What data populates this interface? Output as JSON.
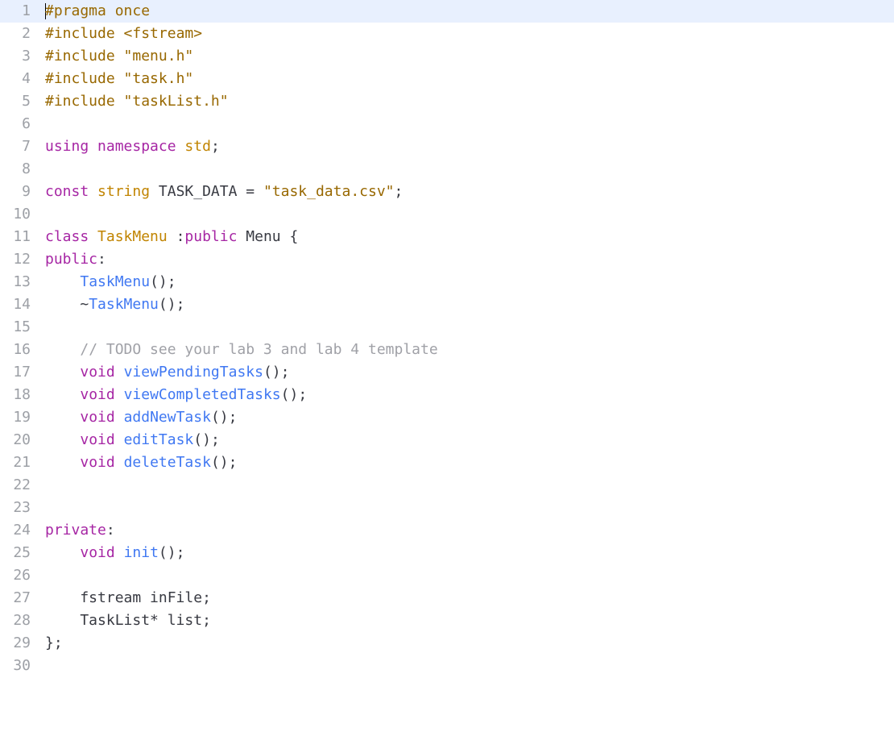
{
  "highlight_line": 1,
  "lines": [
    {
      "n": 1,
      "tokens": [
        {
          "t": "cursor"
        },
        {
          "c": "pp",
          "v": "#pragma"
        },
        {
          "c": "txt",
          "v": " "
        },
        {
          "c": "pp",
          "v": "once"
        }
      ]
    },
    {
      "n": 2,
      "tokens": [
        {
          "c": "pp",
          "v": "#include"
        },
        {
          "c": "txt",
          "v": " "
        },
        {
          "c": "str",
          "v": "<fstream>"
        }
      ]
    },
    {
      "n": 3,
      "tokens": [
        {
          "c": "pp",
          "v": "#include"
        },
        {
          "c": "txt",
          "v": " "
        },
        {
          "c": "str",
          "v": "\"menu.h\""
        }
      ]
    },
    {
      "n": 4,
      "tokens": [
        {
          "c": "pp",
          "v": "#include"
        },
        {
          "c": "txt",
          "v": " "
        },
        {
          "c": "str",
          "v": "\"task.h\""
        }
      ]
    },
    {
      "n": 5,
      "tokens": [
        {
          "c": "pp",
          "v": "#include"
        },
        {
          "c": "txt",
          "v": " "
        },
        {
          "c": "str",
          "v": "\"taskList.h\""
        }
      ]
    },
    {
      "n": 6,
      "tokens": []
    },
    {
      "n": 7,
      "tokens": [
        {
          "c": "kw",
          "v": "using"
        },
        {
          "c": "txt",
          "v": " "
        },
        {
          "c": "kw",
          "v": "namespace"
        },
        {
          "c": "txt",
          "v": " "
        },
        {
          "c": "typ",
          "v": "std"
        },
        {
          "c": "txt",
          "v": ";"
        }
      ]
    },
    {
      "n": 8,
      "tokens": []
    },
    {
      "n": 9,
      "tokens": [
        {
          "c": "kw",
          "v": "const"
        },
        {
          "c": "txt",
          "v": " "
        },
        {
          "c": "typ",
          "v": "string"
        },
        {
          "c": "txt",
          "v": " TASK_DATA = "
        },
        {
          "c": "str",
          "v": "\"task_data.csv\""
        },
        {
          "c": "txt",
          "v": ";"
        }
      ]
    },
    {
      "n": 10,
      "tokens": []
    },
    {
      "n": 11,
      "tokens": [
        {
          "c": "kw",
          "v": "class"
        },
        {
          "c": "txt",
          "v": " "
        },
        {
          "c": "typ",
          "v": "TaskMenu"
        },
        {
          "c": "txt",
          "v": " :"
        },
        {
          "c": "kw",
          "v": "public"
        },
        {
          "c": "txt",
          "v": " Menu {"
        }
      ]
    },
    {
      "n": 12,
      "tokens": [
        {
          "c": "kw",
          "v": "public"
        },
        {
          "c": "txt",
          "v": ":"
        }
      ]
    },
    {
      "n": 13,
      "tokens": [
        {
          "c": "txt",
          "v": "    "
        },
        {
          "c": "fn",
          "v": "TaskMenu"
        },
        {
          "c": "txt",
          "v": "();"
        }
      ]
    },
    {
      "n": 14,
      "tokens": [
        {
          "c": "txt",
          "v": "    ~"
        },
        {
          "c": "fn",
          "v": "TaskMenu"
        },
        {
          "c": "txt",
          "v": "();"
        }
      ]
    },
    {
      "n": 15,
      "tokens": []
    },
    {
      "n": 16,
      "tokens": [
        {
          "c": "txt",
          "v": "    "
        },
        {
          "c": "com",
          "v": "// TODO see your lab 3 and lab 4 template"
        }
      ]
    },
    {
      "n": 17,
      "tokens": [
        {
          "c": "txt",
          "v": "    "
        },
        {
          "c": "kw",
          "v": "void"
        },
        {
          "c": "txt",
          "v": " "
        },
        {
          "c": "fn",
          "v": "viewPendingTasks"
        },
        {
          "c": "txt",
          "v": "();"
        }
      ]
    },
    {
      "n": 18,
      "tokens": [
        {
          "c": "txt",
          "v": "    "
        },
        {
          "c": "kw",
          "v": "void"
        },
        {
          "c": "txt",
          "v": " "
        },
        {
          "c": "fn",
          "v": "viewCompletedTasks"
        },
        {
          "c": "txt",
          "v": "();"
        }
      ]
    },
    {
      "n": 19,
      "tokens": [
        {
          "c": "txt",
          "v": "    "
        },
        {
          "c": "kw",
          "v": "void"
        },
        {
          "c": "txt",
          "v": " "
        },
        {
          "c": "fn",
          "v": "addNewTask"
        },
        {
          "c": "txt",
          "v": "();"
        }
      ]
    },
    {
      "n": 20,
      "tokens": [
        {
          "c": "txt",
          "v": "    "
        },
        {
          "c": "kw",
          "v": "void"
        },
        {
          "c": "txt",
          "v": " "
        },
        {
          "c": "fn",
          "v": "editTask"
        },
        {
          "c": "txt",
          "v": "();"
        }
      ]
    },
    {
      "n": 21,
      "tokens": [
        {
          "c": "txt",
          "v": "    "
        },
        {
          "c": "kw",
          "v": "void"
        },
        {
          "c": "txt",
          "v": " "
        },
        {
          "c": "fn",
          "v": "deleteTask"
        },
        {
          "c": "txt",
          "v": "();"
        }
      ]
    },
    {
      "n": 22,
      "tokens": []
    },
    {
      "n": 23,
      "tokens": []
    },
    {
      "n": 24,
      "tokens": [
        {
          "c": "kw",
          "v": "private"
        },
        {
          "c": "txt",
          "v": ":"
        }
      ]
    },
    {
      "n": 25,
      "tokens": [
        {
          "c": "txt",
          "v": "    "
        },
        {
          "c": "kw",
          "v": "void"
        },
        {
          "c": "txt",
          "v": " "
        },
        {
          "c": "fn",
          "v": "init"
        },
        {
          "c": "txt",
          "v": "();"
        }
      ]
    },
    {
      "n": 26,
      "tokens": []
    },
    {
      "n": 27,
      "tokens": [
        {
          "c": "txt",
          "v": "    fstream inFile;"
        }
      ]
    },
    {
      "n": 28,
      "tokens": [
        {
          "c": "txt",
          "v": "    TaskList* list;"
        }
      ]
    },
    {
      "n": 29,
      "tokens": [
        {
          "c": "txt",
          "v": "};"
        }
      ]
    },
    {
      "n": 30,
      "tokens": []
    }
  ]
}
